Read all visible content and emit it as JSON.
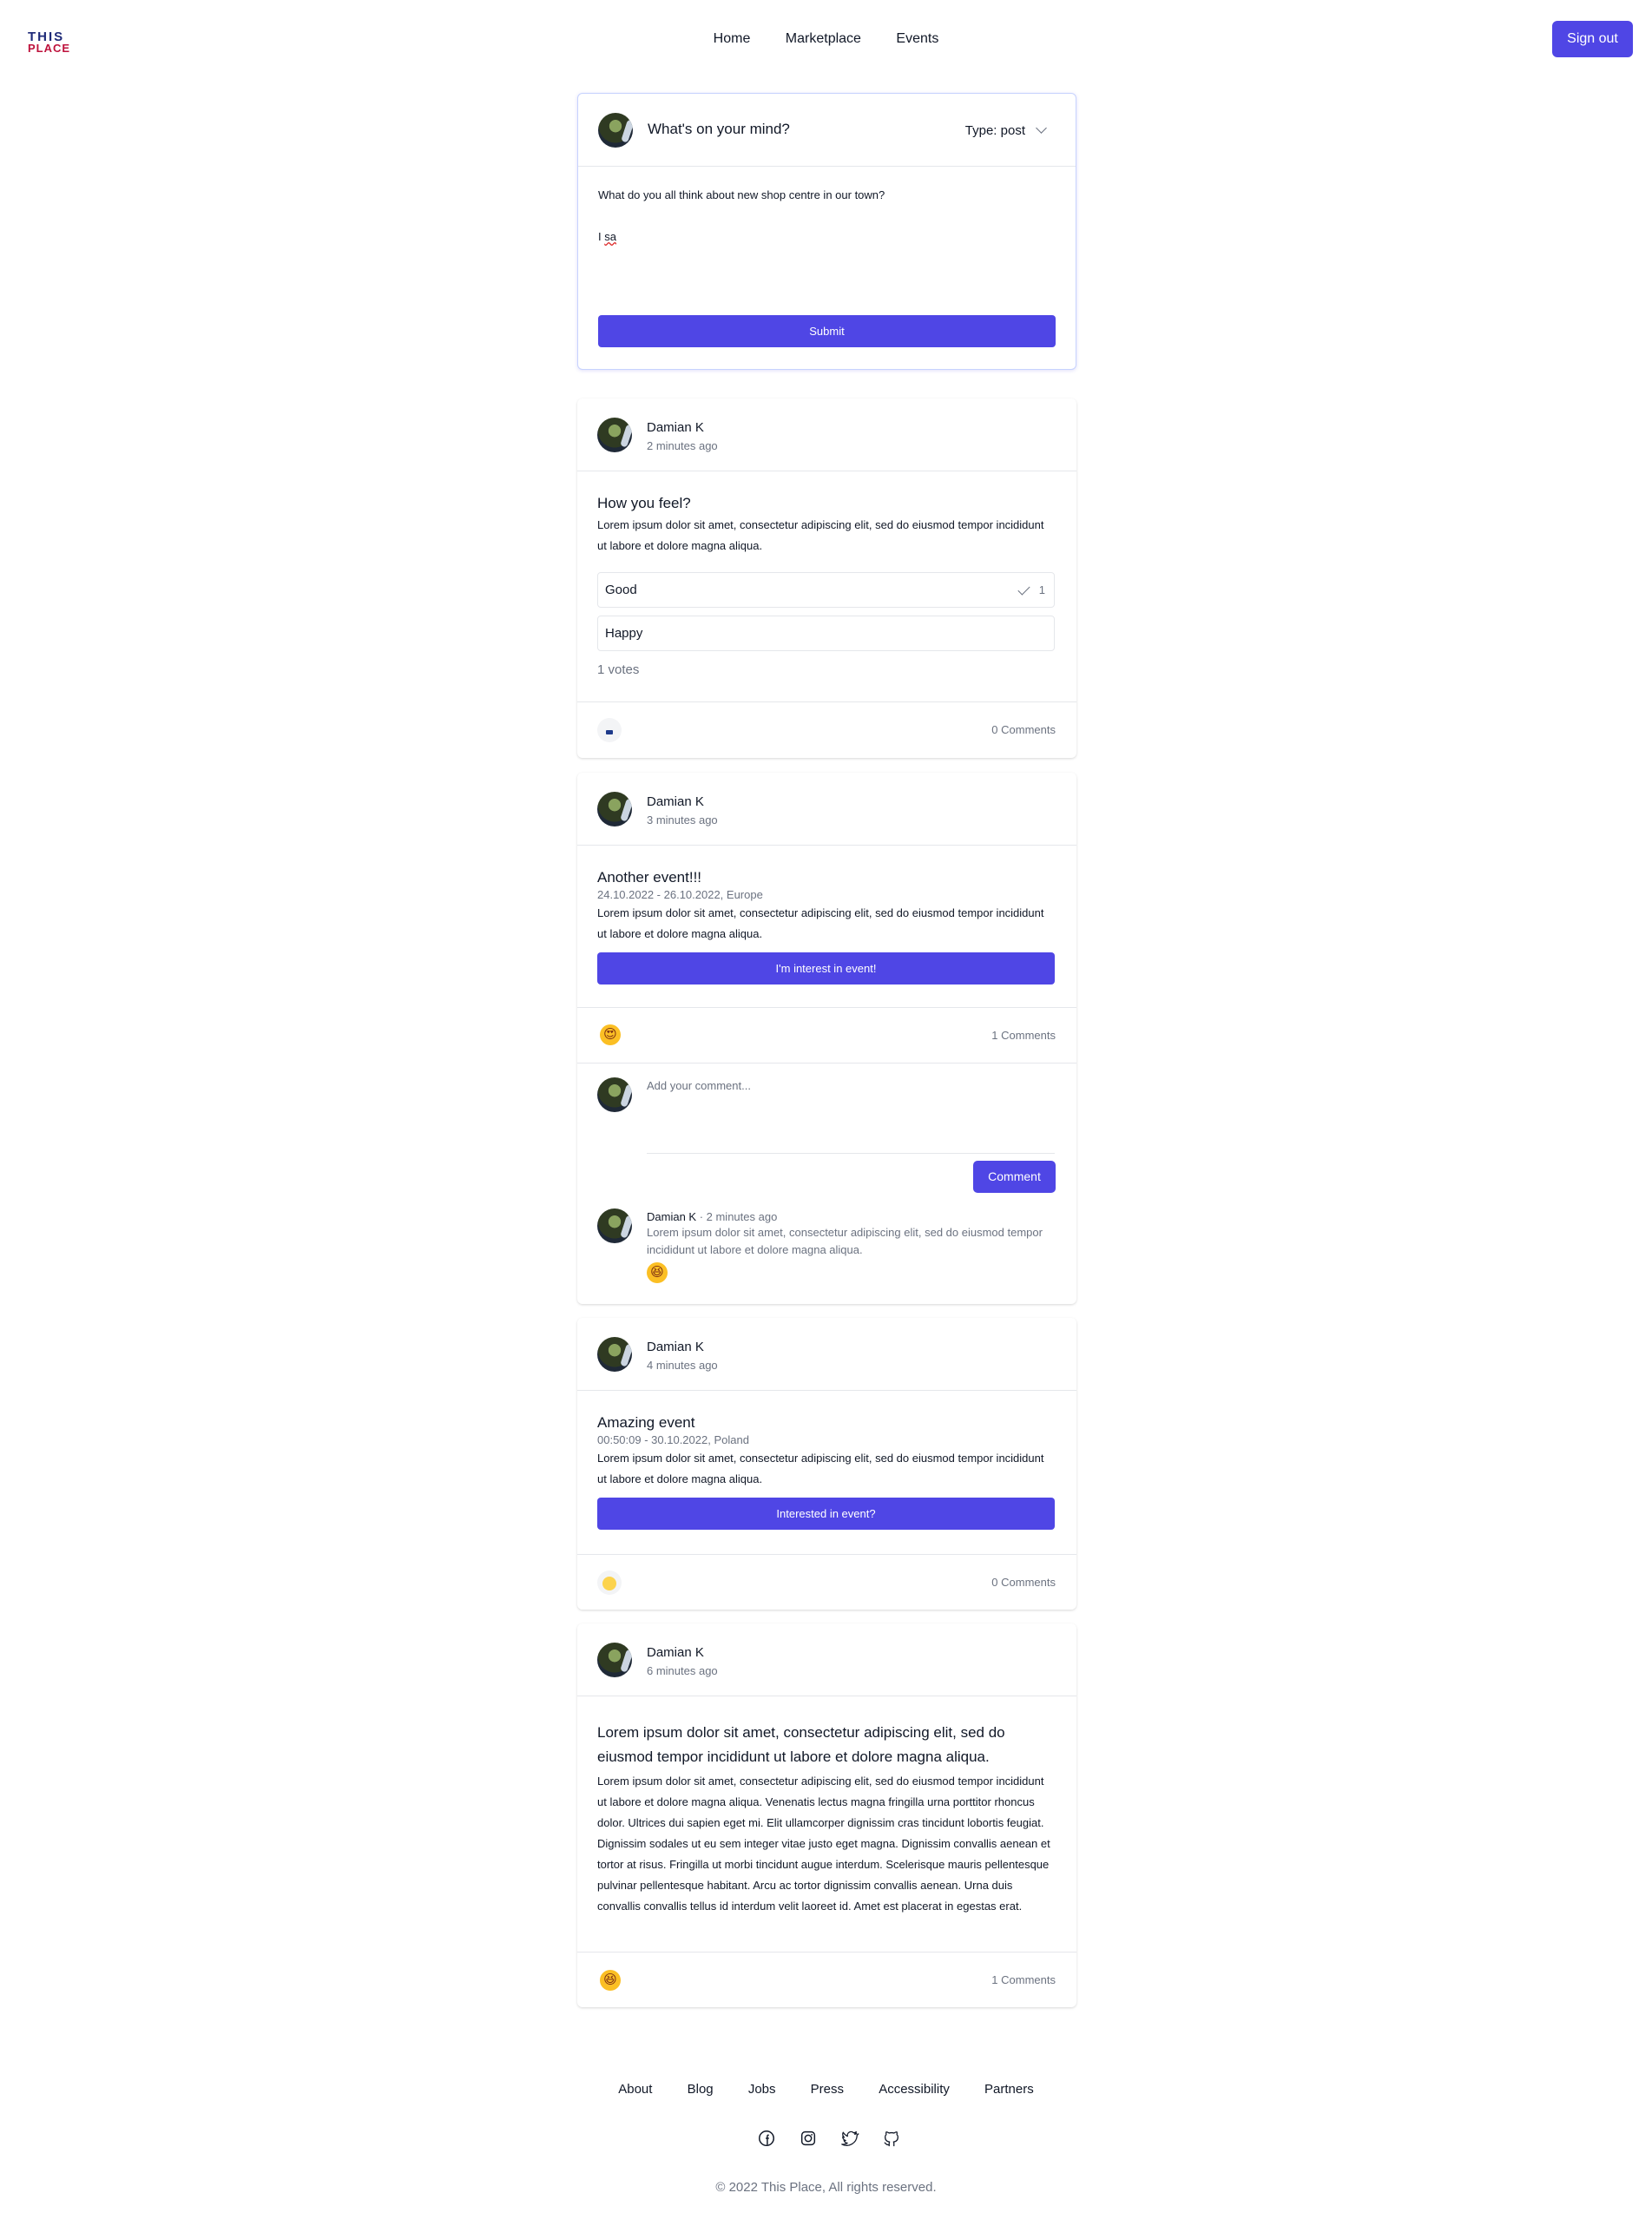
{
  "header": {
    "logo_top": "THIS",
    "logo_bottom": "PLACE",
    "nav": [
      "Home",
      "Marketplace",
      "Events"
    ],
    "signout": "Sign out"
  },
  "composer": {
    "title": "What's on your mind?",
    "type_label": "Type: post",
    "text_line1": "What do you all think about new shop centre in our town?",
    "text_line2_start": "I ",
    "text_line2_typo": "sa",
    "submit": "Submit"
  },
  "posts": [
    {
      "author": "Damian K",
      "time": "2 minutes ago",
      "title": "How you feel?",
      "text": "Lorem ipsum dolor sit amet, consectetur adipiscing elit, sed do eiusmod tempor incididunt ut labore et dolore magna aliqua.",
      "options": [
        {
          "label": "Good",
          "count": "1"
        },
        {
          "label": "Happy",
          "count": ""
        }
      ],
      "votes": "1 votes",
      "comments": "0 Comments"
    },
    {
      "author": "Damian K",
      "time": "3 minutes ago",
      "title": "Another event!!!",
      "subtitle": "24.10.2022 - 26.10.2022, Europe",
      "text": "Lorem ipsum dolor sit amet, consectetur adipiscing elit, sed do eiusmod tempor incididunt ut labore et dolore magna aliqua.",
      "button": "I'm interest in event!",
      "comments": "1 Comments",
      "comment_placeholder": "Add your comment...",
      "comment_button": "Comment",
      "comment": {
        "author": "Damian K",
        "time": " · 2 minutes ago",
        "text": "Lorem ipsum dolor sit amet, consectetur adipiscing elit, sed do eiusmod tempor incididunt ut labore et dolore magna aliqua."
      }
    },
    {
      "author": "Damian K",
      "time": "4 minutes ago",
      "title": "Amazing event",
      "subtitle": "00:50:09 - 30.10.2022, Poland",
      "text": "Lorem ipsum dolor sit amet, consectetur adipiscing elit, sed do eiusmod tempor incididunt ut labore et dolore magna aliqua.",
      "button": "Interested in event?",
      "comments": "0 Comments"
    },
    {
      "author": "Damian K",
      "time": "6 minutes ago",
      "title": "Lorem ipsum dolor sit amet, consectetur adipiscing elit, sed do eiusmod tempor incididunt ut labore et dolore magna aliqua.",
      "text": "Lorem ipsum dolor sit amet, consectetur adipiscing elit, sed do eiusmod tempor incididunt ut labore et dolore magna aliqua. Venenatis lectus magna fringilla urna porttitor rhoncus dolor. Ultrices dui sapien eget mi. Elit ullamcorper dignissim cras tincidunt lobortis feugiat. Dignissim sodales ut eu sem integer vitae justo eget magna. Dignissim convallis aenean et tortor at risus. Fringilla ut morbi tincidunt augue interdum. Scelerisque mauris pellentesque pulvinar pellentesque habitant. Arcu ac tortor dignissim convallis aenean. Urna duis convallis convallis tellus id interdum velit laoreet id. Amet est placerat in egestas erat.",
      "comments": "1 Comments"
    }
  ],
  "footer": {
    "links": [
      "About",
      "Blog",
      "Jobs",
      "Press",
      "Accessibility",
      "Partners"
    ],
    "social_icons": [
      "facebook-icon",
      "instagram-icon",
      "twitter-icon",
      "github-icon"
    ],
    "copyright": "© 2022 This Place, All rights reserved."
  },
  "colors": {
    "accent": "#4f46e5",
    "border": "#e5e7eb",
    "muted": "#6b7280"
  }
}
